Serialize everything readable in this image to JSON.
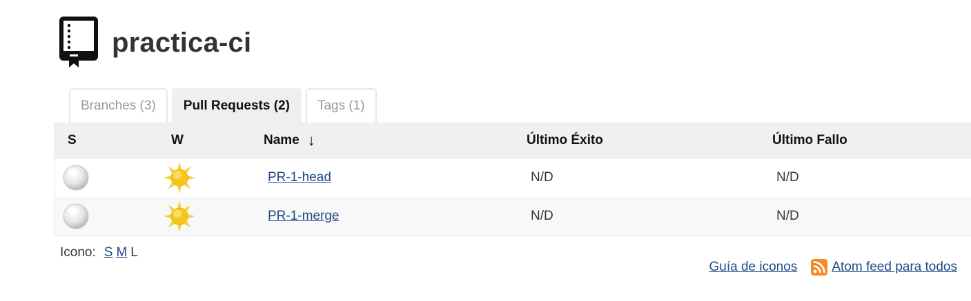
{
  "project": {
    "title": "practica-ci",
    "icon": "repository-book-icon"
  },
  "tabs": [
    {
      "label": "Branches (3)",
      "active": false
    },
    {
      "label": "Pull Requests (2)",
      "active": true
    },
    {
      "label": "Tags (1)",
      "active": false
    }
  ],
  "table": {
    "headers": {
      "status": "S",
      "weather": "W",
      "name": "Name",
      "sort_indicator": "↓",
      "last_success": "Último Éxito",
      "last_failure": "Último Fallo"
    },
    "rows": [
      {
        "status_icon": "not-built-ball-icon",
        "weather_icon": "sunny-weather-icon",
        "name": "PR-1-head",
        "last_success": "N/D",
        "last_failure": "N/D"
      },
      {
        "status_icon": "not-built-ball-icon",
        "weather_icon": "sunny-weather-icon",
        "name": "PR-1-merge",
        "last_success": "N/D",
        "last_failure": "N/D"
      }
    ]
  },
  "icon_size": {
    "label": "Icono:",
    "options": [
      {
        "label": "S",
        "link": true
      },
      {
        "label": "M",
        "link": true
      },
      {
        "label": "L",
        "link": false
      }
    ]
  },
  "footer": {
    "legend_link": "Guía de iconos",
    "feed_icon": "rss-feed-icon",
    "feed_link": "Atom feed para todos"
  },
  "colors": {
    "link": "#204a87",
    "header_bg": "#f0f0f0",
    "rss_orange": "#f28c28"
  }
}
